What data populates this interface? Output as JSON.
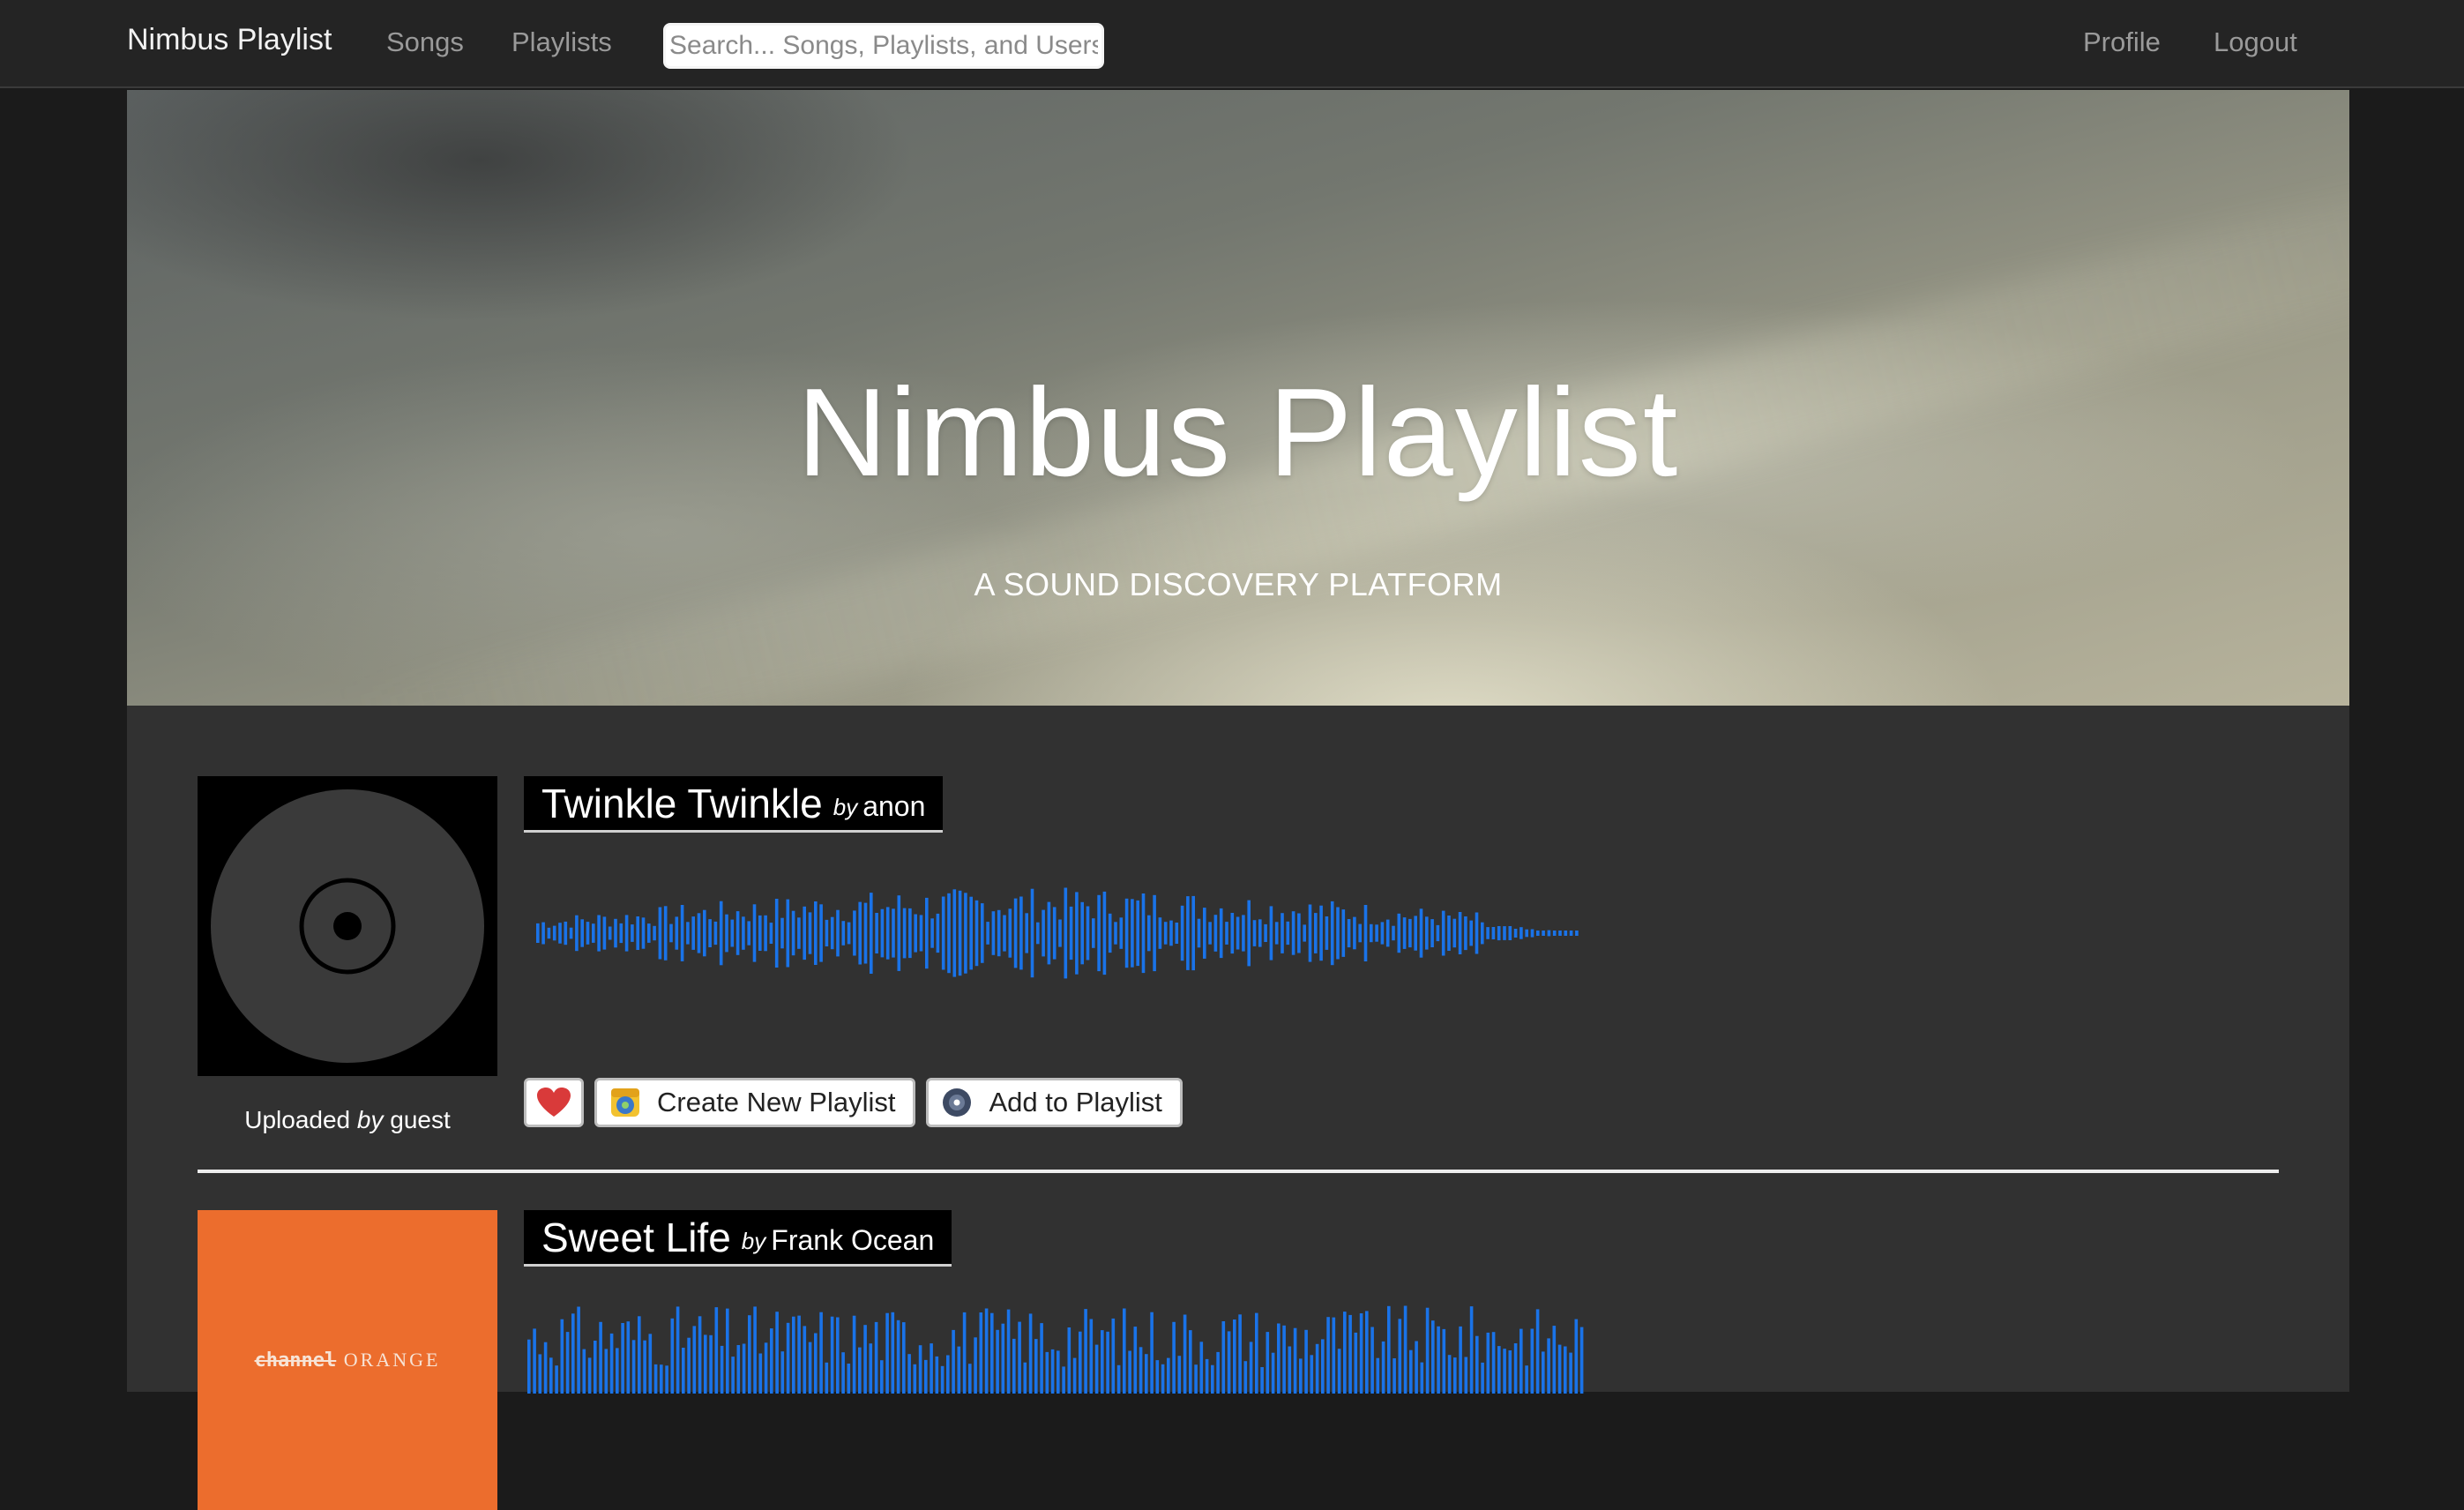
{
  "nav": {
    "brand": "Nimbus Playlist",
    "links": [
      "Songs",
      "Playlists"
    ],
    "search_placeholder": "Search... Songs, Playlists, and Users",
    "right_links": [
      "Profile",
      "Logout"
    ]
  },
  "hero": {
    "title": "Nimbus Playlist",
    "subtitle": "A SOUND DISCOVERY PLATFORM"
  },
  "songs": [
    {
      "title": "Twinkle Twinkle",
      "by": "by",
      "artist": "anon",
      "album_icon": "vinyl-record-icon",
      "uploaded_prefix": "Uploaded",
      "uploaded_by": "by",
      "uploader": "guest",
      "actions": {
        "like_icon": "heart-icon",
        "create_label": "Create New Playlist",
        "create_icon": "playlist-create-icon",
        "add_label": "Add to Playlist",
        "add_icon": "disc-icon"
      }
    },
    {
      "title": "Sweet Life",
      "by": "by",
      "artist": "Frank Ocean",
      "album_text_struck": "channel",
      "album_text": "ORANGE"
    }
  ],
  "colors": {
    "waveform": "#1a73e8",
    "orange_album": "#ec6d2d",
    "heart": "#d93a3a"
  }
}
